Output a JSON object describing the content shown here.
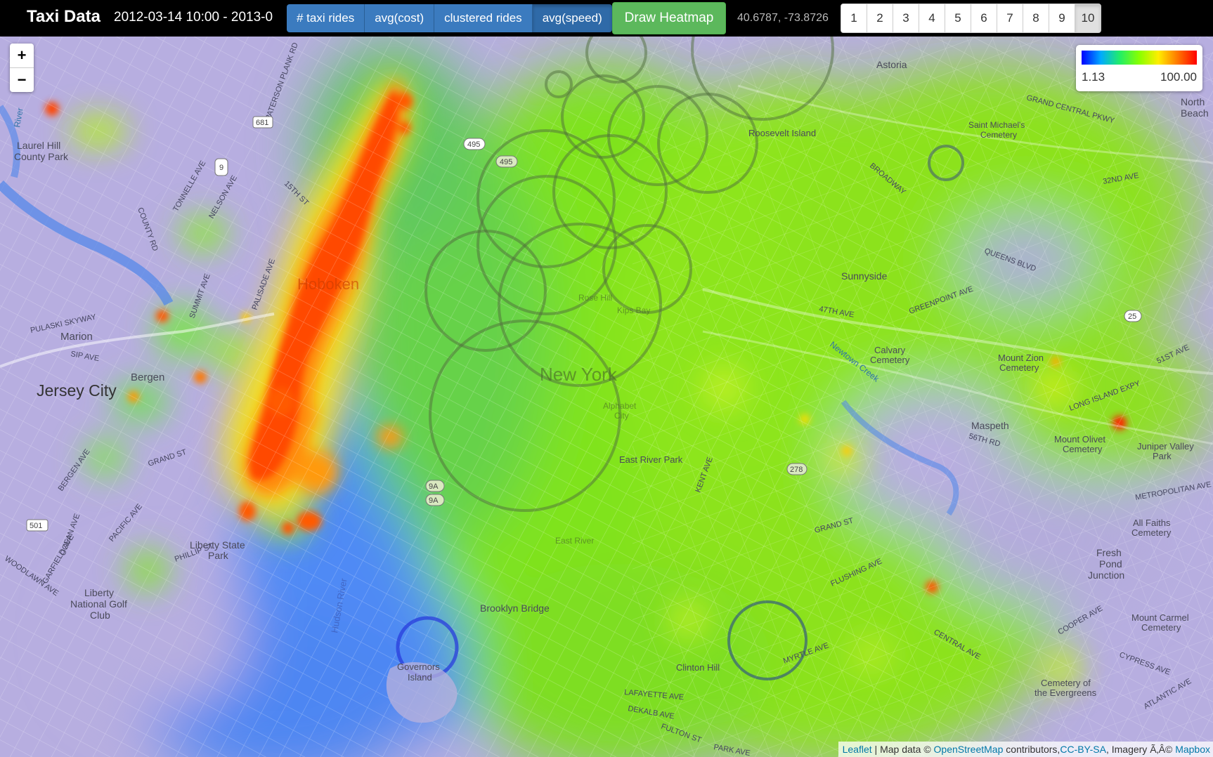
{
  "header": {
    "brand": "Taxi Data",
    "date_range": "2012-03-14 10:00 - 2013-0",
    "metric_buttons": [
      "# taxi rides",
      "avg(cost)",
      "clustered rides",
      "avg(speed)"
    ],
    "active_metric": "avg(speed)",
    "draw_button": "Draw Heatmap",
    "coordinates": "40.6787, -73.8726",
    "pages": [
      "1",
      "2",
      "3",
      "4",
      "5",
      "6",
      "7",
      "8",
      "9",
      "10"
    ],
    "active_page": "10"
  },
  "map": {
    "zoom_in": "+",
    "zoom_out": "−",
    "labels": {
      "hoboken": "Hoboken",
      "jersey_city": "Jersey City",
      "new_york": "New York",
      "marion": "Marion",
      "bergen": "Bergen",
      "laurel_hill": "Laurel Hill",
      "county_park": "County Park",
      "liberty_state": "Liberty State",
      "park": "Park",
      "liberty": "Liberty",
      "national_golf": "National Golf",
      "club": "Club",
      "governors": "Governors",
      "island": "Island",
      "brooklyn_bridge": "Brooklyn Bridge",
      "astoria": "Astoria",
      "roosevelt_island": "Roosevelt Island",
      "sunnyside": "Sunnyside",
      "maspeth": "Maspeth",
      "calvary": "Calvary",
      "cemetery": "Cemetery",
      "mount_zion": "Mount Zion",
      "mount_olivet": "Mount Olivet",
      "juniper_valley": "Juniper Valley",
      "all_faiths": "All Faiths",
      "fresh_pond": "Fresh",
      "pond": "Pond",
      "junction": "Junction",
      "mount_carmel": "Mount Carmel",
      "evergreens": "Cemetery of",
      "the_evergreens": "the Evergreens",
      "east_river_park": "East River Park",
      "clinton_hill": "Clinton Hill",
      "rose_hill": "Rose Hill",
      "kips_bay": "Kips Bay",
      "alphabet_city": "Alphabet",
      "city": "City",
      "east_river": "East River",
      "hudson_river": "Hudson River",
      "north_beach": "North",
      "beach": "Beach",
      "st_michaels": "Saint Michael's",
      "newtown_creek": "Newtown Creek",
      "river": "River"
    },
    "roads": [
      "PULASKI SKYWAY",
      "SIP AVE",
      "GRAND ST",
      "BERGEN AVE",
      "PACIFIC AVE",
      "OCEAN AVE",
      "WOODLAWN AVE",
      "GARFIELD AVE",
      "PHILLIP ST",
      "TONNELLE AVE",
      "NELSON AVE",
      "COUNTY RD",
      "SUMMIT AVE",
      "PALISADE AVE",
      "PATERSON PLANK RD",
      "15TH ST",
      "QUEENS BLVD",
      "GRAND CENTRAL PKWY",
      "BROADWAY",
      "LONG ISLAND EXPY",
      "METROPOLITAN AVE",
      "MYRTLE AVE",
      "FLUSHING AVE",
      "CENTRAL AVE",
      "CYPRESS AVE",
      "COOPER AVE",
      "ATLANTIC AVE",
      "DEKALB AVE",
      "LAFAYETTE AVE",
      "FULTON ST",
      "PARK AVE",
      "KENT AVE",
      "GRAND ST",
      "47TH AVE",
      "GREENPOINT AVE",
      "51ST AVE",
      "56TH RD",
      "32ND AVE"
    ],
    "route_shields": [
      "681",
      "9",
      "495",
      "495",
      "9A",
      "9A",
      "278",
      "25",
      "501"
    ]
  },
  "legend": {
    "min": "1.13",
    "max": "100.00"
  },
  "attribution": {
    "leaflet": "Leaflet",
    "map_data": "| Map data ©",
    "osm": "OpenStreetMap",
    "contributors": "contributors,",
    "license": "CC-BY-SA",
    "imagery": ", Imagery Ã‚Â©",
    "mapbox": "Mapbox"
  },
  "colors": {
    "accent_blue": "#3b7bbf",
    "draw_green": "#5cb85c",
    "heat_low": "#9aa0ff",
    "heat_mid": "#8fe81a",
    "heat_high": "#ff3300"
  }
}
